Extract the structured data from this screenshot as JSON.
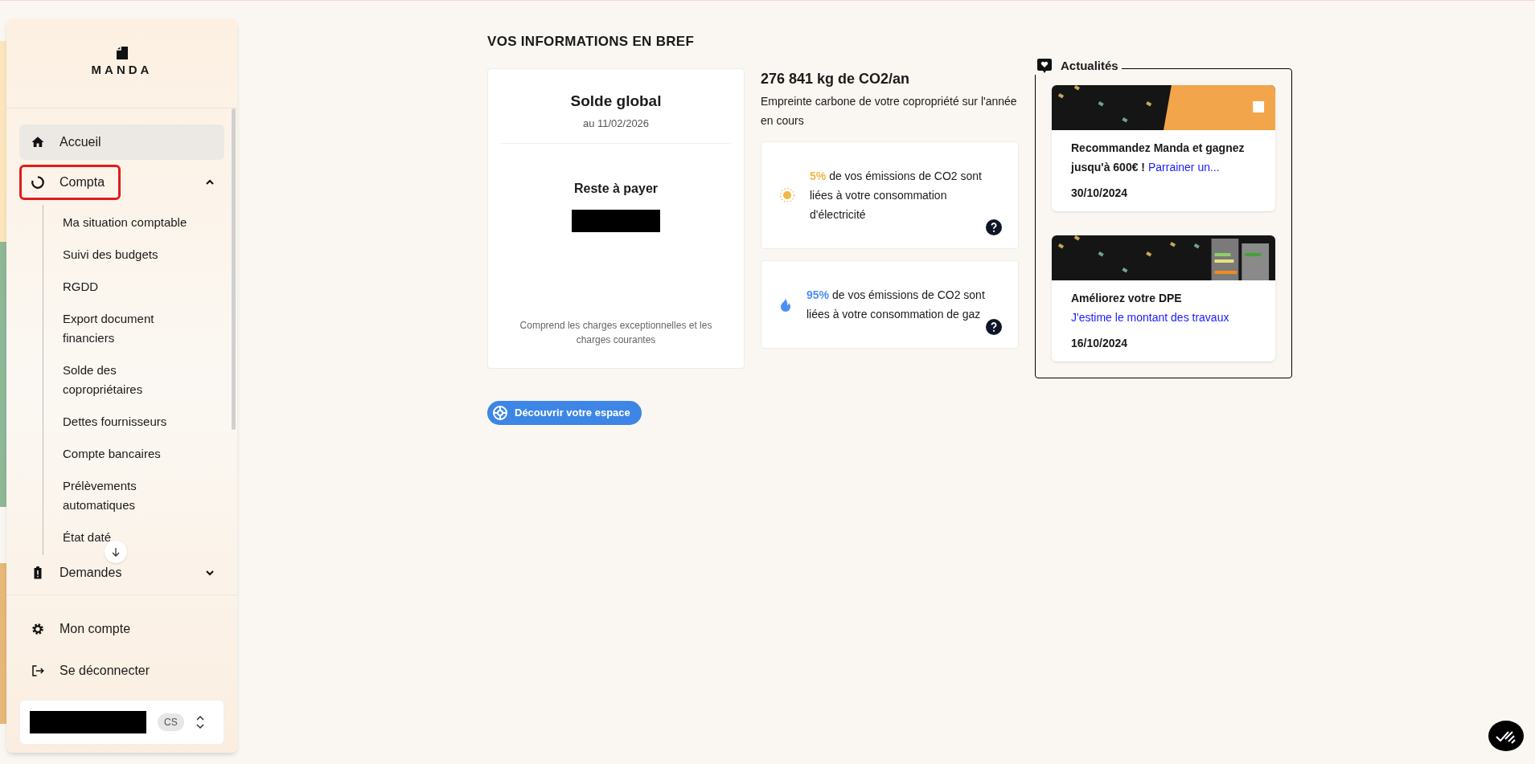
{
  "sidebar": {
    "logo": "MANDA",
    "items": [
      {
        "label": "Accueil",
        "selected": true,
        "highlighted": false
      },
      {
        "label": "Compta",
        "selected": false,
        "expanded": true,
        "highlighted": true,
        "children": [
          {
            "label": "Ma situation comptable"
          },
          {
            "label": "Suivi des budgets"
          },
          {
            "label": "RGDD"
          },
          {
            "label": "Export document financiers"
          },
          {
            "label": "Solde des copropriétaires"
          },
          {
            "label": "Dettes fournisseurs"
          },
          {
            "label": "Compte bancaires"
          },
          {
            "label": "Prélèvements automatiques"
          },
          {
            "label": "État daté"
          }
        ]
      },
      {
        "label": "Demandes",
        "selected": false,
        "expanded": false,
        "highlighted": false
      }
    ],
    "footer_items": [
      {
        "label": "Mon compte"
      },
      {
        "label": "Se déconnecter"
      }
    ],
    "account": {
      "badge": "CS"
    }
  },
  "main": {
    "title": "VOS INFORMATIONS EN BREF",
    "balance": {
      "title": "Solde global",
      "date": "au 11/02/2026",
      "label": "Reste à payer",
      "note": "Comprend les charges exceptionnelles et les charges courantes"
    },
    "carbon": {
      "total": "276 841 kg de CO2/an",
      "subtitle": "Empreinte carbone de votre copropriété sur l'année en cours",
      "cards": [
        {
          "kind": "sun",
          "percent": "5%",
          "text": "de vos émissions de CO2 sont liées à votre consommation d'électricité",
          "color": "#f0b847"
        },
        {
          "kind": "flame",
          "percent": "95%",
          "text": "de vos émissions de CO2 sont liées à votre consommation de gaz",
          "color": "#4d8ef5"
        }
      ]
    },
    "discover_button": "Découvrir votre espace"
  },
  "news": {
    "title": "Actualités",
    "items": [
      {
        "kind": "orange",
        "title": "Recommandez Manda et gagnez jusqu'à 600€ !",
        "link": "Parrainer un...",
        "date": "30/10/2024"
      },
      {
        "kind": "dark",
        "title": "Améliorez votre DPE",
        "link": "J'estime le montant des travaux",
        "date": "16/10/2024"
      }
    ]
  }
}
